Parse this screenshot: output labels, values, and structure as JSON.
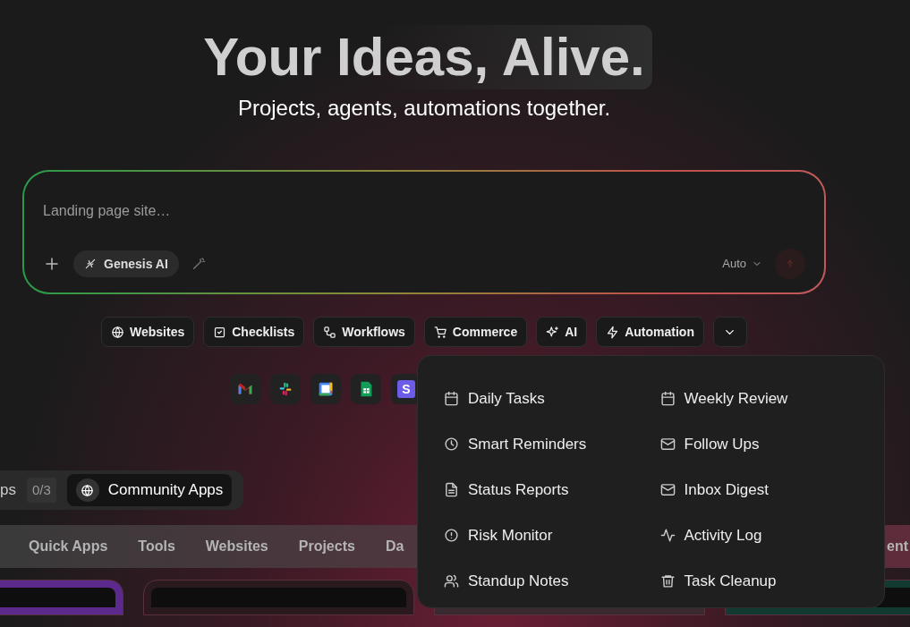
{
  "hero": {
    "title": "Your Ideas, Alive.",
    "subtitle": "Projects, agents, automations together."
  },
  "prompt": {
    "placeholder": "Landing page site…",
    "model": "Genesis AI",
    "mode": "Auto"
  },
  "categories": [
    {
      "label": "Websites",
      "kind": "globe"
    },
    {
      "label": "Checklists",
      "kind": "check"
    },
    {
      "label": "Workflows",
      "kind": "flow"
    },
    {
      "label": "Commerce",
      "kind": "cart"
    },
    {
      "label": "AI",
      "kind": "sparkles"
    },
    {
      "label": "Automation",
      "kind": "bolt"
    }
  ],
  "integrations": [
    {
      "kind": "mail"
    },
    {
      "kind": "chat"
    },
    {
      "kind": "calendar"
    },
    {
      "kind": "sheet"
    },
    {
      "kind": "letter",
      "text": "S"
    }
  ],
  "menu": [
    {
      "label": "Daily Tasks",
      "kind": "calendar"
    },
    {
      "label": "Weekly Review",
      "kind": "calendar"
    },
    {
      "label": "Smart Reminders",
      "kind": "clock"
    },
    {
      "label": "Follow Ups",
      "kind": "mail"
    },
    {
      "label": "Status Reports",
      "kind": "file"
    },
    {
      "label": "Inbox Digest",
      "kind": "mail"
    },
    {
      "label": "Risk Monitor",
      "kind": "alert"
    },
    {
      "label": "Activity Log",
      "kind": "pulse"
    },
    {
      "label": "Standup Notes",
      "kind": "users"
    },
    {
      "label": "Task Cleanup",
      "kind": "trash"
    }
  ],
  "app_switch": [
    {
      "label": "ps",
      "count": "0/3",
      "selected": false
    },
    {
      "label": "Community Apps",
      "selected": true
    }
  ],
  "gallery_tabs": [
    "Quick Apps",
    "Tools",
    "Websites",
    "Projects",
    "Da",
    "ent"
  ],
  "cards": [
    {
      "color": "#5b2a8c"
    },
    {
      "color": "#2a1a1e"
    },
    {
      "color": "#3a2a30"
    },
    {
      "color": "#123a33"
    }
  ]
}
